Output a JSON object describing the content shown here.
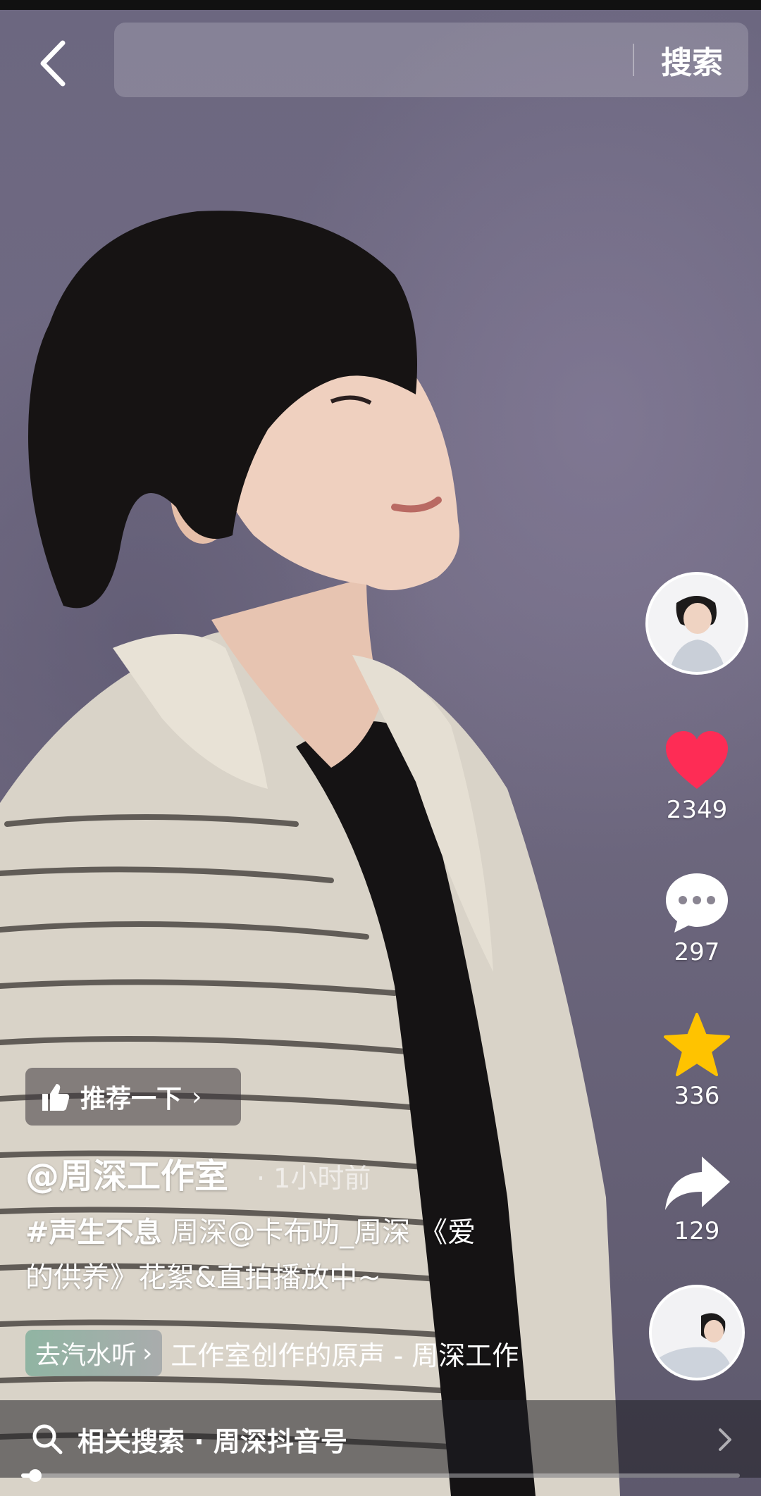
{
  "header": {
    "search_button_label": "搜索",
    "search_placeholder": ""
  },
  "actions": {
    "likes": "2349",
    "comments": "297",
    "favorites": "336",
    "shares": "129"
  },
  "post": {
    "recommend_label": "推荐一下",
    "author": "@周深工作室",
    "time_ago": "· 1小时前",
    "hashtag": "#声生不息",
    "description_line1": " 周深@卡布叻_周深 《爱",
    "description_line2": "的供养》花絮&直拍播放中~",
    "music_chip": "去汽水听",
    "music_title": "工作室创作的原声 - 周深工作"
  },
  "related_search": {
    "label": "相关搜索 · 周深抖音号"
  },
  "playback": {
    "progress_fraction": 0.02
  },
  "colors": {
    "like": "#fe2c55",
    "favorite": "#ffc300"
  }
}
